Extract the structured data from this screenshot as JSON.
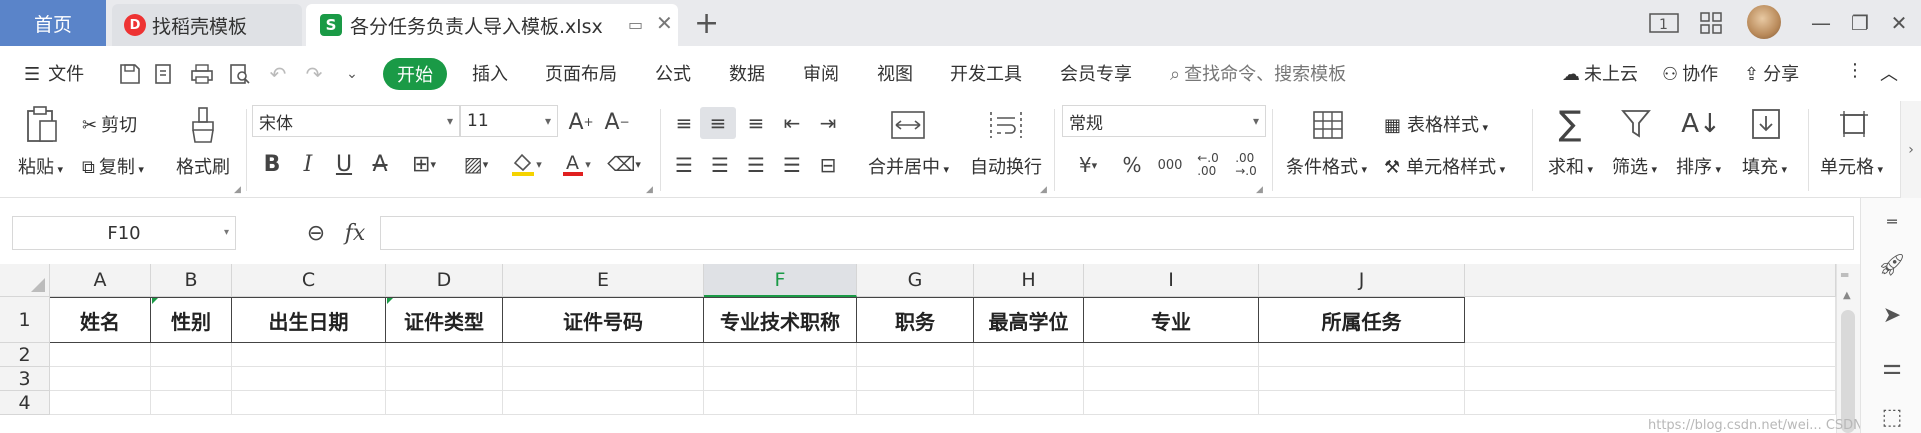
{
  "tabs": {
    "home": "首页",
    "docer": "找稻壳模板",
    "file": "各分任务负责人导入模板.xlsx"
  },
  "menu": {
    "file": "文件",
    "items": [
      "开始",
      "插入",
      "页面布局",
      "公式",
      "数据",
      "审阅",
      "视图",
      "开发工具",
      "会员专享"
    ],
    "search_placeholder": "查找命令、搜索模板",
    "cloud": "未上云",
    "collab": "协作",
    "share": "分享"
  },
  "ribbon": {
    "paste": "粘贴",
    "cut": "剪切",
    "copy": "复制",
    "format_painter": "格式刷",
    "font_name": "宋体",
    "font_size": "11",
    "merge_center": "合并居中",
    "wrap_text": "自动换行",
    "number_format": "常规",
    "conditional_format": "条件格式",
    "table_style": "表格样式",
    "cell_style": "单元格样式",
    "sum": "求和",
    "filter": "筛选",
    "sort": "排序",
    "fill": "填充",
    "cells": "单元格"
  },
  "formula_bar": {
    "name_box": "F10",
    "fx": "fx",
    "value": ""
  },
  "sheet": {
    "columns": [
      "A",
      "B",
      "C",
      "D",
      "E",
      "F",
      "G",
      "H",
      "I",
      "J"
    ],
    "selected_column": "F",
    "rows": [
      "1",
      "2",
      "3",
      "4"
    ],
    "header_row": [
      "姓名",
      "性别",
      "出生日期",
      "证件类型",
      "证件号码",
      "专业技术职称",
      "职务",
      "最高学位",
      "专业",
      "所属任务"
    ]
  },
  "watermark": "https://blog.csdn.net/wei... CSDN @搬砖的"
}
